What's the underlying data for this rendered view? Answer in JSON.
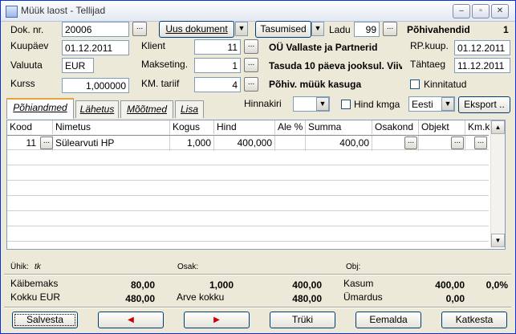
{
  "window": {
    "title": "Müük laost - Tellijad",
    "minimize": "–",
    "restore": "▫",
    "close": "✕"
  },
  "header": {
    "dok_nr_label": "Dok. nr.",
    "dok_nr": "20006",
    "new_doc": "Uus dokument",
    "payments": "Tasumised",
    "ladu_label": "Ladu",
    "ladu": "99",
    "main_means": "Põhivahendid",
    "main_means_val": "1",
    "kuupaev_label": "Kuupäev",
    "kuupaev": "01.12.2011",
    "klient_label": "Klient",
    "klient": "11",
    "klient_name": "OÜ Vallaste ja Partnerid",
    "rpkuup_label": "RP.kuup.",
    "rpkuup": "01.12.2011",
    "valuuta_label": "Valuuta",
    "valuuta": "EUR",
    "makseting_label": "Makseting.",
    "makseting": "1",
    "makseting_text": "Tasuda 10 päeva jooksul. Viiv",
    "tahtaeg_label": "Tähtaeg",
    "tahtaeg": "11.12.2011",
    "kurss_label": "Kurss",
    "kurss": "1,000000",
    "km_label": "KM. tariif",
    "km": "4",
    "km_text": "Põhiv. müük kasuga",
    "kinnitatud": "Kinnitatud"
  },
  "tabs": [
    "Põhiandmed",
    "Lähetus",
    "Mõõtmed",
    "Lisa"
  ],
  "filters": {
    "hinnakiri_label": "Hinnakiri",
    "hind_kmga": "Hind kmga",
    "language": "Eesti",
    "export": "Eksport .."
  },
  "grid": {
    "columns": [
      "Kood",
      "Nimetus",
      "Kogus",
      "Hind",
      "Ale %",
      "Summa",
      "Osakond",
      "Objekt",
      "Km.koo"
    ],
    "rows": [
      {
        "kood": "11",
        "nimetus": "Sülearvuti HP",
        "kogus": "1,000",
        "hind": "400,000",
        "ale": "",
        "summa": "400,00"
      }
    ]
  },
  "info": {
    "uhik_label": "Ühik:",
    "uhik": "tk",
    "osak_label": "Osak:",
    "obj_label": "Obj:"
  },
  "totals": {
    "kaibemaks_label": "Käibemaks",
    "kaibemaks": "80,00",
    "qty": "1,000",
    "sum": "400,00",
    "kasum_label": "Kasum",
    "kasum": "400,00",
    "kasum_pct": "0,0%",
    "kokku_label": "Kokku EUR",
    "kokku": "480,00",
    "arve_label": "Arve kokku",
    "arve": "480,00",
    "umardus_label": "Ümardus",
    "umardus": "0,00"
  },
  "buttons": {
    "save": "Salvesta",
    "prev": "◀",
    "next": "▶",
    "print": "Trüki",
    "remove": "Eemalda",
    "cancel": "Katkesta"
  },
  "colors": {
    "accent": "#e8a33d",
    "nav_arrow": "#cc0000"
  }
}
